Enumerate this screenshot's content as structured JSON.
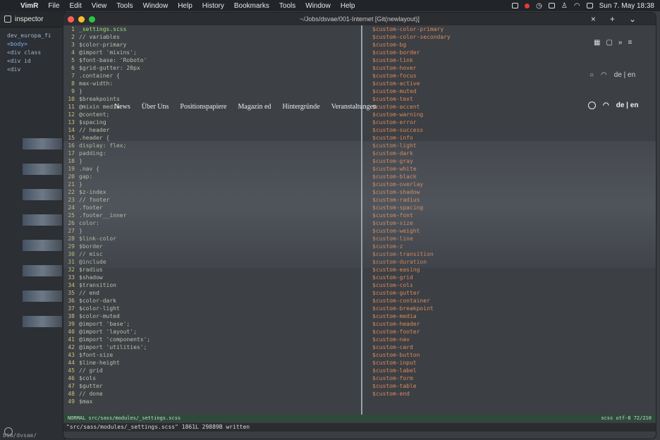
{
  "menubar": {
    "app": "VimR",
    "items": [
      "File",
      "Edit",
      "View",
      "Tools",
      "Window",
      "Help",
      "History",
      "Bookmarks",
      "Tools",
      "Window",
      "Help"
    ],
    "clock": "Sun 7. May  18:38"
  },
  "inspector": {
    "tab_label": "inspector",
    "lines": [
      "dev_europa_fi",
      "<body>",
      "<div class",
      "<div id",
      "<div"
    ],
    "footer": "bim/dvsae/"
  },
  "terminal": {
    "title": "~/Jobs/dsvae/001-Internet [Git(newlayout)]",
    "left_first": "_settings.scss",
    "left_lines": [
      "// variables",
      "$color-primary",
      "@import 'mixins';",
      "$font-base: 'Roboto'",
      "$grid-gutter: 20px",
      "  .container {",
      "    max-width:",
      "  }",
      "$breakpoints",
      "@mixin media",
      "  @content;",
      "$spacing",
      "// header",
      ".header {",
      "  display: flex;",
      "  padding:",
      "}",
      ".nav {",
      "  gap:",
      "}",
      "$z-index",
      "// footer",
      ".footer",
      ".footer__inner",
      "  color:",
      "}",
      "$link-color",
      "$border",
      "// misc",
      "@include",
      "$radius",
      "$shadow",
      "$transition",
      "// end",
      "$color-dark",
      "$color-light",
      "$color-muted",
      "@import 'base';",
      "@import 'layout';",
      "@import 'components';",
      "@import 'utilities';",
      "$font-size",
      "$line-height",
      "// grid",
      "$cols",
      "$gutter",
      "// done",
      "$max"
    ],
    "right_lines": [
      "$custom-color-primary",
      "$custom-color-secondary",
      "$custom-bg",
      "$custom-border",
      "$custom-link",
      "$custom-hover",
      "$custom-focus",
      "$custom-active",
      "$custom-muted",
      "$custom-text",
      "$custom-accent",
      "$custom-warning",
      "$custom-error",
      "$custom-success",
      "$custom-info",
      "$custom-light",
      "$custom-dark",
      "$custom-gray",
      "$custom-white",
      "$custom-black",
      "$custom-overlay",
      "$custom-shadow",
      "$custom-radius",
      "$custom-spacing",
      "$custom-font",
      "$custom-size",
      "$custom-weight",
      "$custom-line",
      "$custom-z",
      "$custom-transition",
      "$custom-duration",
      "$custom-easing",
      "$custom-grid",
      "$custom-cols",
      "$custom-gutter",
      "$custom-container",
      "$custom-breakpoint",
      "$custom-media",
      "$custom-header",
      "$custom-footer",
      "$custom-nav",
      "$custom-card",
      "$custom-button",
      "$custom-input",
      "$custom-label",
      "$custom-form",
      "$custom-table",
      "$custom-end"
    ],
    "status_left": "NORMAL  src/sass/modules/_settings.scss",
    "status_right": "scss  utf-8  72/210",
    "cmdline": "\"src/sass/modules/_settings.scss\" 1861L 29889B written"
  },
  "site": {
    "nav": [
      "News",
      "Über Uns",
      "Positionspapiere",
      "Magazin ed",
      "Hintergründe",
      "Veranstaltungen"
    ],
    "lang": "de | en"
  }
}
